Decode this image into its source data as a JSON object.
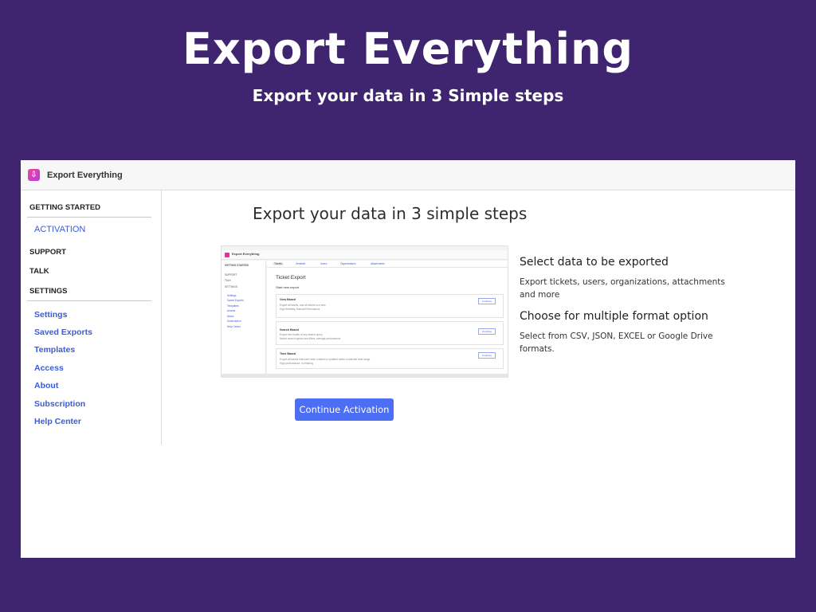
{
  "hero": {
    "title": "Export Everything",
    "subtitle": "Export your data in 3 Simple steps"
  },
  "app": {
    "name": "Export Everything",
    "logo_icon": "download-icon"
  },
  "sidebar": {
    "getting_started": "GETTING STARTED",
    "activation": "ACTIVATION",
    "support": "SUPPORT",
    "talk": "TALK",
    "settings_head": "SETTINGS",
    "items": [
      "Settings",
      "Saved Exports",
      "Templates",
      "Access",
      "About",
      "Subscription",
      "Help Center"
    ]
  },
  "main": {
    "title": "Export your data in 3 simple steps",
    "cta_label": "Continue Activation"
  },
  "features": [
    {
      "heading": "Select data to be exported",
      "text": "Export tickets, users, organizations, attachments and more"
    },
    {
      "heading": "Choose for multiple format option",
      "text": "Select from CSV, JSON, EXCEL or Google Drive formats."
    }
  ],
  "preview": {
    "app_name": "Export Everything",
    "side": [
      "GETTING STARTED",
      "SUPPORT",
      "TALK",
      "SETTINGS",
      "Settings",
      "Saved Exports",
      "Templates",
      "Access",
      "About",
      "Subscription",
      "Help Center"
    ],
    "tabs": [
      "Tickets",
      "Zendesk",
      "Users",
      "Organizations",
      "Attachments"
    ],
    "heading": "Ticket Export",
    "subheading": "Start new export",
    "cards": [
      {
        "title": "View Based",
        "desc1": "Export all tickets, and all tickets in a view",
        "desc2": "High flexibility, Natural Performance",
        "button": "Continue"
      },
      {
        "title": "Search Based",
        "desc1": "Export the results of any search query",
        "desc2": "Native search syntax and filters, average performance",
        "button": "Continue"
      },
      {
        "title": "Time Based",
        "desc1": "Export all tickets that have been created or updated within a selected date range",
        "desc2": "High performance, no filtering",
        "button": "Continue"
      }
    ]
  },
  "colors": {
    "background": "#3f2470",
    "accent": "#4c6ef5",
    "link": "#3b5bdb"
  }
}
